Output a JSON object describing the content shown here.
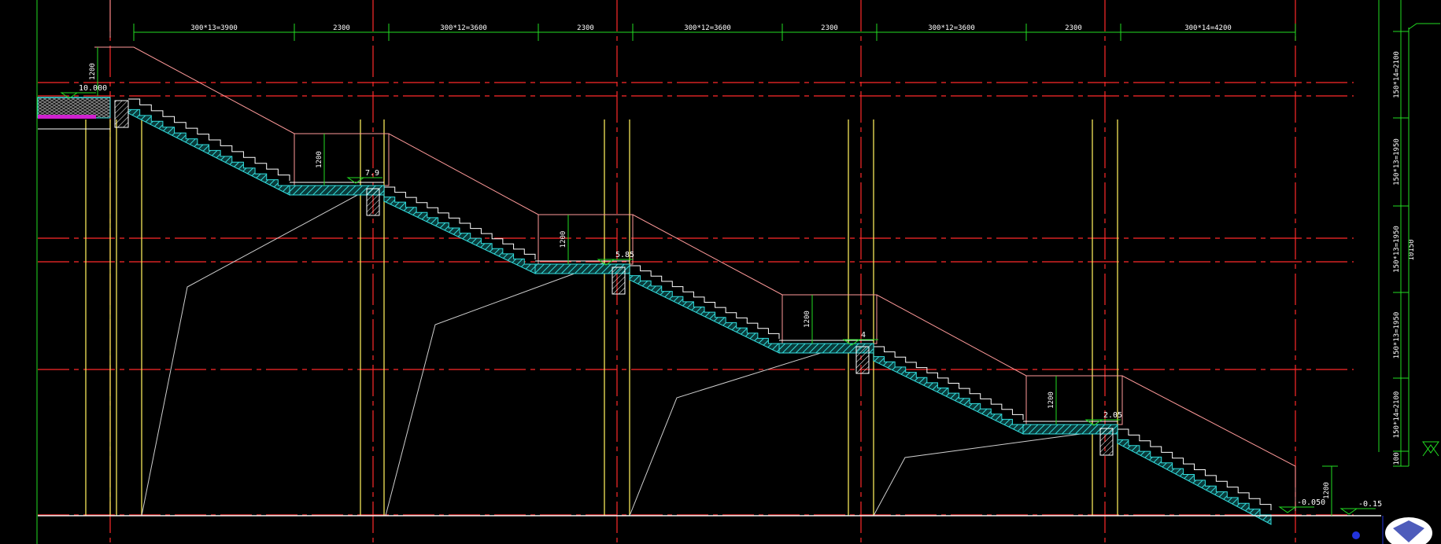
{
  "drawing": {
    "top_dimensions": [
      "300*13=3900",
      "2300",
      "300*12=3600",
      "2300",
      "300*12=3600",
      "2300",
      "300*12=3600",
      "2300",
      "300*14=4200"
    ],
    "right_dimensions": [
      "150*14=2100",
      "150*13=1950",
      "150*13=1950",
      "150*13=1950",
      "150*14=2100",
      "100"
    ],
    "total_height": "10150",
    "landing_heights": [
      "1200",
      "1200",
      "1200",
      "1200",
      "1200"
    ],
    "railing_height_top": "1200",
    "railing_height_bottom": "1200",
    "levels": {
      "top": "10.000",
      "landing_1": "7.9",
      "landing_2": "5.85",
      "landing_3": "4",
      "landing_4": "2.05",
      "bottom": "-0.050",
      "ground": "-0.15"
    },
    "colors": {
      "background": "#000000",
      "axis": "#ff2a2a",
      "outline": "#ff9a9a",
      "dimension": "#22dd22",
      "column": "#f5e65a",
      "stair_fill": "#33dddd",
      "ground": "#f0f0f0",
      "support": "#cfcfcf",
      "hatch": "#ffffff"
    }
  }
}
